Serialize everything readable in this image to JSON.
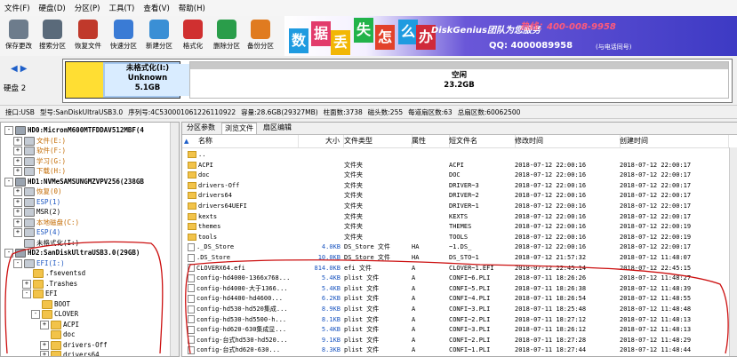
{
  "menu": [
    "文件(F)",
    "硬盘(D)",
    "分区(P)",
    "工具(T)",
    "查看(V)",
    "帮助(H)"
  ],
  "toolbar": [
    {
      "label": "保存更改",
      "icon": "save-icon",
      "color": "#6d7c8c"
    },
    {
      "label": "搜索分区",
      "icon": "search-partition-icon",
      "color": "#5a6a7a"
    },
    {
      "label": "恢复文件",
      "icon": "recover-file-icon",
      "color": "#c0392b"
    },
    {
      "label": "快速分区",
      "icon": "quick-partition-icon",
      "color": "#3a7bd5"
    },
    {
      "label": "新建分区",
      "icon": "new-partition-icon",
      "color": "#3a8fd5"
    },
    {
      "label": "格式化",
      "icon": "format-icon",
      "color": "#d03030"
    },
    {
      "label": "删除分区",
      "icon": "delete-partition-icon",
      "color": "#2a9d4a"
    },
    {
      "label": "备份分区",
      "icon": "backup-partition-icon",
      "color": "#e07b20"
    }
  ],
  "ad": {
    "tiles": [
      "数",
      "据",
      "丢",
      "失",
      "怎",
      "么",
      "办"
    ],
    "tile_colors": [
      "#1f9be0",
      "#e23b6b",
      "#f2b705",
      "#22b34a",
      "#e2412a",
      "#1f9be0",
      "#d02a3a"
    ],
    "title": "DiskGenius团队为您服务",
    "hotline": "热线：400-008-9958",
    "qq": "QQ: 4000089958",
    "qq_note": "(与电话同号)"
  },
  "disk_band": {
    "disk_label": "硬盘 2",
    "partition1": {
      "name": "未格式化(I:)",
      "fs": "Unknown",
      "size": "5.1GB"
    },
    "partition2": {
      "name": "空闲",
      "size": "23.2GB"
    }
  },
  "infobar": {
    "interface": "接口:USB",
    "model": "型号:SanDiskUltraUSB3.0",
    "serial": "序列号:4C530001061226110922",
    "capacity": "容量:28.6GB(29327MB)",
    "cylinders": "柱面数:3738",
    "heads": "磁头数:255",
    "sectors": "每道扇区数:63",
    "total_sectors": "总扇区数:60062500"
  },
  "tree": [
    {
      "label": "HD0:MicronM600MTFDDAV512MBF(4",
      "level": 0,
      "exp": "-",
      "icon": "disk"
    },
    {
      "label": "文件(E:)",
      "level": 1,
      "exp": "+",
      "icon": "part",
      "color": "#c36a00"
    },
    {
      "label": "软件(F:)",
      "level": 1,
      "exp": "+",
      "icon": "part",
      "color": "#c36a00"
    },
    {
      "label": "学习(G:)",
      "level": 1,
      "exp": "+",
      "icon": "part",
      "color": "#c36a00"
    },
    {
      "label": "下载(H:)",
      "level": 1,
      "exp": "+",
      "icon": "part",
      "color": "#c36a00"
    },
    {
      "label": "HD1:NVMeSAMSUNGMZVPV256(238GB",
      "level": 0,
      "exp": "-",
      "icon": "disk"
    },
    {
      "label": "恢复(0)",
      "level": 1,
      "exp": "+",
      "icon": "part",
      "color": "#c36a00"
    },
    {
      "label": "ESP(1)",
      "level": 1,
      "exp": "+",
      "icon": "part",
      "color": "#1a55c0"
    },
    {
      "label": "MSR(2)",
      "level": 1,
      "exp": "+",
      "icon": "part",
      "color": "#000000"
    },
    {
      "label": "本地磁盘(C:)",
      "level": 1,
      "exp": "+",
      "icon": "part",
      "color": "#c36a00"
    },
    {
      "label": "ESP(4)",
      "level": 1,
      "exp": "+",
      "icon": "part",
      "color": "#1a55c0"
    },
    {
      "label": "未格式化(I:)",
      "level": 1,
      "exp": "",
      "icon": "part",
      "color": "#000000"
    },
    {
      "label": "HD2:SanDiskUltraUSB3.0(29GB)",
      "level": 0,
      "exp": "-",
      "icon": "disk"
    },
    {
      "label": "EFI(I:)",
      "level": 1,
      "exp": "-",
      "icon": "part",
      "color": "#1a55c0"
    },
    {
      "label": ".fseventsd",
      "level": 2,
      "exp": "",
      "icon": "folder",
      "color": "#000000"
    },
    {
      "label": ".Trashes",
      "level": 2,
      "exp": "+",
      "icon": "folder",
      "color": "#000000"
    },
    {
      "label": "EFI",
      "level": 2,
      "exp": "-",
      "icon": "folder",
      "color": "#000000"
    },
    {
      "label": "BOOT",
      "level": 3,
      "exp": "",
      "icon": "folder",
      "color": "#000000"
    },
    {
      "label": "CLOVER",
      "level": 3,
      "exp": "-",
      "icon": "folder",
      "color": "#000000"
    },
    {
      "label": "ACPI",
      "level": 4,
      "exp": "+",
      "icon": "folder",
      "color": "#000000"
    },
    {
      "label": "doc",
      "level": 4,
      "exp": "",
      "icon": "folder",
      "color": "#000000"
    },
    {
      "label": "drivers-Off",
      "level": 4,
      "exp": "+",
      "icon": "folder",
      "color": "#000000"
    },
    {
      "label": "drivers64",
      "level": 4,
      "exp": "+",
      "icon": "folder",
      "color": "#000000"
    }
  ],
  "tabs": [
    "分区参数",
    "浏览文件",
    "扇区编辑"
  ],
  "columns": [
    "名称",
    "大小",
    "文件类型",
    "属性",
    "短文件名",
    "修改时间",
    "创建时间"
  ],
  "files": [
    {
      "icon": "folder",
      "name": "..",
      "size": "",
      "type": "",
      "attr": "",
      "short": "",
      "mtime": "",
      "ctime": ""
    },
    {
      "icon": "folder",
      "name": "ACPI",
      "size": "",
      "type": "文件夹",
      "attr": "",
      "short": "ACPI",
      "mtime": "2018-07-12 22:00:16",
      "ctime": "2018-07-12 22:00:17"
    },
    {
      "icon": "folder",
      "name": "doc",
      "size": "",
      "type": "文件夹",
      "attr": "",
      "short": "DOC",
      "mtime": "2018-07-12 22:00:16",
      "ctime": "2018-07-12 22:00:17"
    },
    {
      "icon": "folder",
      "name": "drivers-Off",
      "size": "",
      "type": "文件夹",
      "attr": "",
      "short": "DRIVER~3",
      "mtime": "2018-07-12 22:00:16",
      "ctime": "2018-07-12 22:00:17"
    },
    {
      "icon": "folder",
      "name": "drivers64",
      "size": "",
      "type": "文件夹",
      "attr": "",
      "short": "DRIVER~2",
      "mtime": "2018-07-12 22:00:16",
      "ctime": "2018-07-12 22:00:17"
    },
    {
      "icon": "folder",
      "name": "drivers64UEFI",
      "size": "",
      "type": "文件夹",
      "attr": "",
      "short": "DRIVER~1",
      "mtime": "2018-07-12 22:00:16",
      "ctime": "2018-07-12 22:00:17"
    },
    {
      "icon": "folder",
      "name": "kexts",
      "size": "",
      "type": "文件夹",
      "attr": "",
      "short": "KEXTS",
      "mtime": "2018-07-12 22:00:16",
      "ctime": "2018-07-12 22:00:17"
    },
    {
      "icon": "folder",
      "name": "themes",
      "size": "",
      "type": "文件夹",
      "attr": "",
      "short": "THEMES",
      "mtime": "2018-07-12 22:00:16",
      "ctime": "2018-07-12 22:00:19"
    },
    {
      "icon": "folder",
      "name": "tools",
      "size": "",
      "type": "文件夹",
      "attr": "",
      "short": "TOOLS",
      "mtime": "2018-07-12 22:00:16",
      "ctime": "2018-07-12 22:00:19"
    },
    {
      "icon": "file",
      "name": "._DS_Store",
      "size": "4.0KB",
      "type": "DS_Store 文件",
      "attr": "HA",
      "short": "~1.DS_",
      "mtime": "2018-07-12 22:00:16",
      "ctime": "2018-07-12 22:00:17"
    },
    {
      "icon": "file",
      "name": ".DS_Store",
      "size": "10.0KB",
      "type": "DS_Store 文件",
      "attr": "HA",
      "short": "DS_STO~1",
      "mtime": "2018-07-12 21:57:32",
      "ctime": "2018-07-12 11:48:07"
    },
    {
      "icon": "file",
      "name": "CLOVERX64.efi",
      "size": "814.0KB",
      "type": "efi 文件",
      "attr": "A",
      "short": "CLOVER~1.EFI",
      "mtime": "2018-07-12 22:45:14",
      "ctime": "2018-07-12 22:45:15"
    },
    {
      "icon": "file",
      "name": "config-hd4000-1366x768...",
      "size": "5.4KB",
      "type": "plist 文件",
      "attr": "A",
      "short": "CONFI~6.PLI",
      "mtime": "2018-07-11 18:26:26",
      "ctime": "2018-07-12 11:48:27"
    },
    {
      "icon": "file",
      "name": "config-hd4000-大于1366...",
      "size": "5.4KB",
      "type": "plist 文件",
      "attr": "A",
      "short": "CONFI~5.PLI",
      "mtime": "2018-07-11 18:26:38",
      "ctime": "2018-07-12 11:48:39"
    },
    {
      "icon": "file",
      "name": "config-hd4400-hd4600...",
      "size": "6.2KB",
      "type": "plist 文件",
      "attr": "A",
      "short": "CONFI~4.PLI",
      "mtime": "2018-07-11 18:26:54",
      "ctime": "2018-07-12 11:48:55"
    },
    {
      "icon": "file",
      "name": "config-hd530-hd520集成...",
      "size": "8.9KB",
      "type": "plist 文件",
      "attr": "A",
      "short": "CONFI~3.PLI",
      "mtime": "2018-07-11 18:25:48",
      "ctime": "2018-07-12 11:48:48"
    },
    {
      "icon": "file",
      "name": "config-hd530-hd5500-h...",
      "size": "8.1KB",
      "type": "plist 文件",
      "attr": "A",
      "short": "CONFI~2.PLI",
      "mtime": "2018-07-11 18:27:12",
      "ctime": "2018-07-12 11:48:13"
    },
    {
      "icon": "file",
      "name": "config-hd620-630集成显...",
      "size": "5.4KB",
      "type": "plist 文件",
      "attr": "A",
      "short": "CONFI~3.PLI",
      "mtime": "2018-07-11 18:26:12",
      "ctime": "2018-07-12 11:48:13"
    },
    {
      "icon": "file",
      "name": "config-台式hd530-hd520...",
      "size": "9.1KB",
      "type": "plist 文件",
      "attr": "A",
      "short": "CONFI~2.PLI",
      "mtime": "2018-07-11 18:27:28",
      "ctime": "2018-07-12 11:48:29"
    },
    {
      "icon": "file",
      "name": "config-台式hd620-630...",
      "size": "8.3KB",
      "type": "plist 文件",
      "attr": "A",
      "short": "CONFI~1.PLI",
      "mtime": "2018-07-11 18:27:44",
      "ctime": "2018-07-12 11:48:44"
    }
  ],
  "annotation_color": "#cc1010"
}
